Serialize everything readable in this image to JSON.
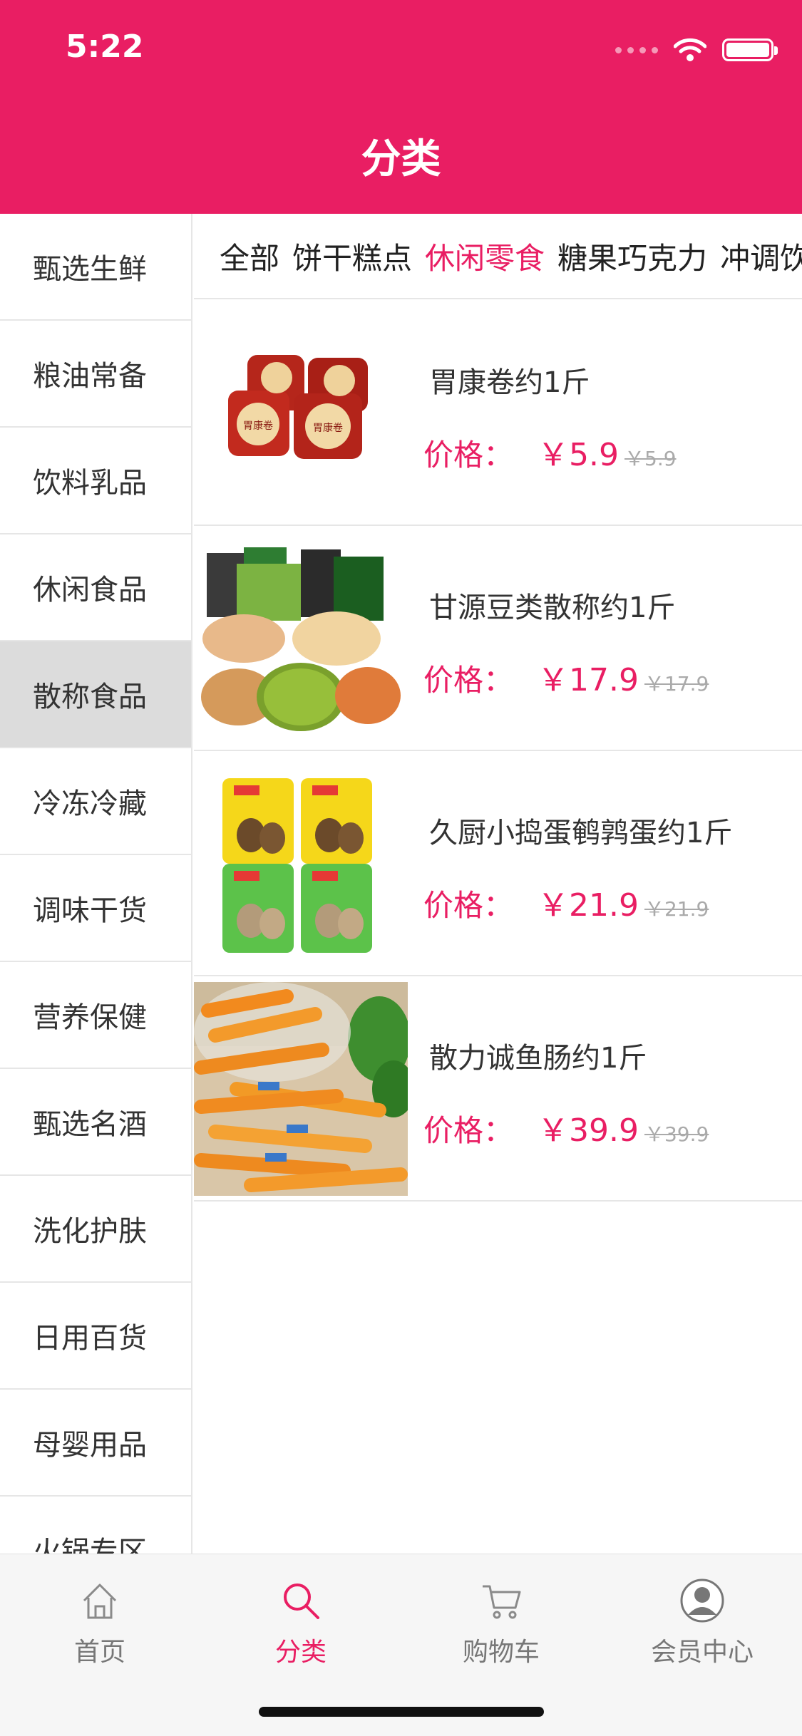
{
  "status_bar": {
    "time": "5:22"
  },
  "header": {
    "title": "分类"
  },
  "sidebar": {
    "items": [
      {
        "label": "甄选生鲜",
        "active": false
      },
      {
        "label": "粮油常备",
        "active": false
      },
      {
        "label": "饮料乳品",
        "active": false
      },
      {
        "label": "休闲食品",
        "active": false
      },
      {
        "label": "散称食品",
        "active": true
      },
      {
        "label": "冷冻冷藏",
        "active": false
      },
      {
        "label": "调味干货",
        "active": false
      },
      {
        "label": "营养保健",
        "active": false
      },
      {
        "label": "甄选名酒",
        "active": false
      },
      {
        "label": "洗化护肤",
        "active": false
      },
      {
        "label": "日用百货",
        "active": false
      },
      {
        "label": "母婴用品",
        "active": false
      },
      {
        "label": "火锅专区",
        "active": false
      }
    ]
  },
  "subtabs": {
    "items": [
      {
        "label": "全部",
        "active": false
      },
      {
        "label": "饼干糕点",
        "active": false
      },
      {
        "label": "休闲零食",
        "active": true
      },
      {
        "label": "糖果巧克力",
        "active": false
      },
      {
        "label": "冲调饮",
        "active": false
      }
    ]
  },
  "products": [
    {
      "name": "胃康卷约1斤",
      "price_label": "价格：",
      "price": "￥5.9",
      "original_price": "￥5.9",
      "image": "stomach-rolls-image"
    },
    {
      "name": "甘源豆类散称约1斤",
      "price_label": "价格：",
      "price": "￥17.9",
      "original_price": "￥17.9",
      "image": "mixed-beans-image"
    },
    {
      "name": "久厨小捣蛋鹌鹑蛋约1斤",
      "price_label": "价格：",
      "price": "￥21.9",
      "original_price": "￥21.9",
      "image": "quail-eggs-image"
    },
    {
      "name": "散力诚鱼肠约1斤",
      "price_label": "价格：",
      "price": "￥39.9",
      "original_price": "￥39.9",
      "image": "fish-sausage-image"
    }
  ],
  "tabbar": {
    "items": [
      {
        "label": "首页",
        "icon": "home-icon",
        "active": false
      },
      {
        "label": "分类",
        "icon": "search-icon",
        "active": true
      },
      {
        "label": "购物车",
        "icon": "cart-icon",
        "active": false
      },
      {
        "label": "会员中心",
        "icon": "profile-icon",
        "active": false
      }
    ]
  },
  "colors": {
    "accent": "#e91e63",
    "divider": "#e6e6e6",
    "sidebar_active": "#dcdcdc",
    "tabbar_bg": "#f6f6f6"
  }
}
